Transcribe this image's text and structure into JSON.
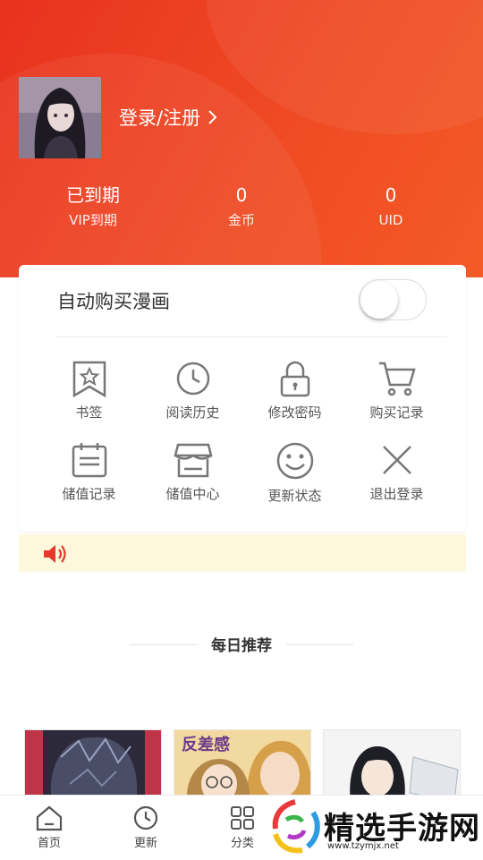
{
  "profile": {
    "login_label": "登录/注册",
    "stats": [
      {
        "value": "已到期",
        "label": "VIP到期"
      },
      {
        "value": "0",
        "label": "金币"
      },
      {
        "value": "0",
        "label": "UID"
      }
    ]
  },
  "settings": {
    "auto_buy_label": "自动购买漫画",
    "auto_buy_enabled": false
  },
  "menu": [
    {
      "label": "书签",
      "icon": "bookmark-star-icon"
    },
    {
      "label": "阅读历史",
      "icon": "clock-icon"
    },
    {
      "label": "修改密码",
      "icon": "lock-icon"
    },
    {
      "label": "购买记录",
      "icon": "cart-icon"
    },
    {
      "label": "储值记录",
      "icon": "clipboard-list-icon"
    },
    {
      "label": "储值中心",
      "icon": "store-icon"
    },
    {
      "label": "更新状态",
      "icon": "smiley-icon"
    },
    {
      "label": "退出登录",
      "icon": "close-x-icon"
    }
  ],
  "notice": {
    "icon": "speaker-icon",
    "text": ""
  },
  "recommend": {
    "title": "每日推荐"
  },
  "tabbar": [
    {
      "label": "首页",
      "icon": "home-icon"
    },
    {
      "label": "更新",
      "icon": "clock-icon"
    },
    {
      "label": "分类",
      "icon": "grid-icon"
    }
  ],
  "watermark": {
    "text": "精选手游网",
    "url": "www.tzymjx.net"
  },
  "colors": {
    "header_start": "#e8321e",
    "header_end": "#f45a26",
    "notice_bg": "#fdf8dc",
    "speaker": "#e8372b"
  }
}
